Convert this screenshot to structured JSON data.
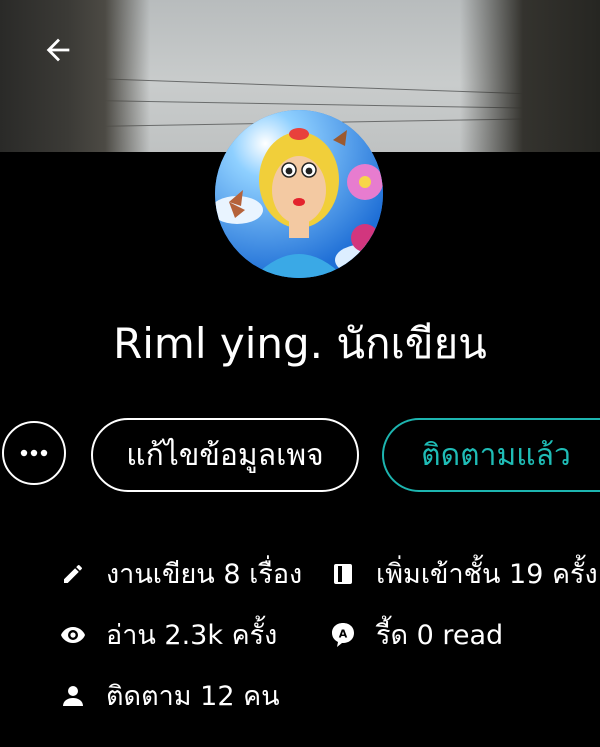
{
  "header": {
    "back_icon": "arrow-back-icon"
  },
  "profile": {
    "name": "Riml ying. นักเขียน"
  },
  "actions": {
    "more_icon": "more-horizontal-icon",
    "edit_label": "แก้ไขข้อมูลเพจ",
    "follow_label": "ติดตามแล้ว",
    "follow_color": "#1fbcb6"
  },
  "stats": {
    "works": "งานเขียน 8 เรื่อง",
    "works_icon": "pencil-icon",
    "bookshelf": "เพิ่มเข้าชั้น 19 ครั้ง",
    "bookshelf_icon": "book-icon",
    "reads": "อ่าน 2.3k ครั้ง",
    "reads_icon": "eye-icon",
    "reads_label": "รี้ด 0 read",
    "reads_label_icon": "read-badge-icon",
    "following": "ติดตาม 12 คน",
    "following_icon": "person-icon"
  }
}
